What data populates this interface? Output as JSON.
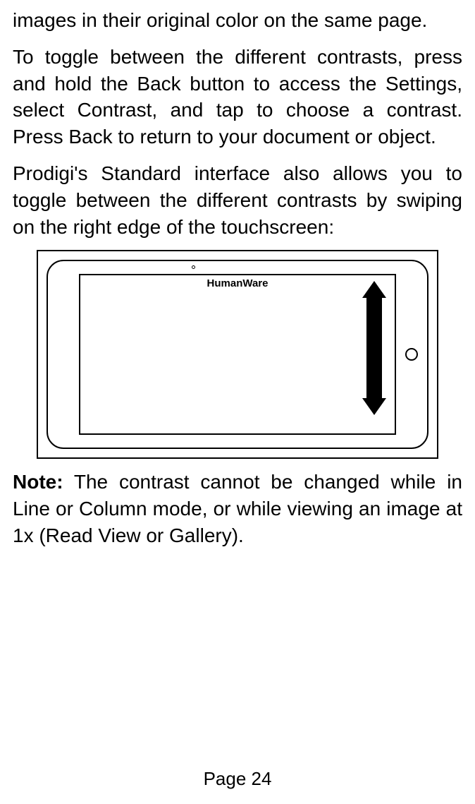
{
  "paragraphs": {
    "p1": "images in their original color on the same page.",
    "p2": "To toggle between the different contrasts, press and hold the Back button to access the Settings, select Contrast, and tap to choose a contrast. Press Back to return to your document or object.",
    "p3": "Prodigi's Standard interface also allows you to toggle between the different contrasts by swiping on the right edge of the touchscreen:"
  },
  "device": {
    "brand": "HumanWare"
  },
  "note": {
    "label": "Note:",
    "text": " The contrast cannot be changed while in Line or Column mode, or while viewing an image at 1x (Read View or Gallery)."
  },
  "page_number": "Page 24"
}
